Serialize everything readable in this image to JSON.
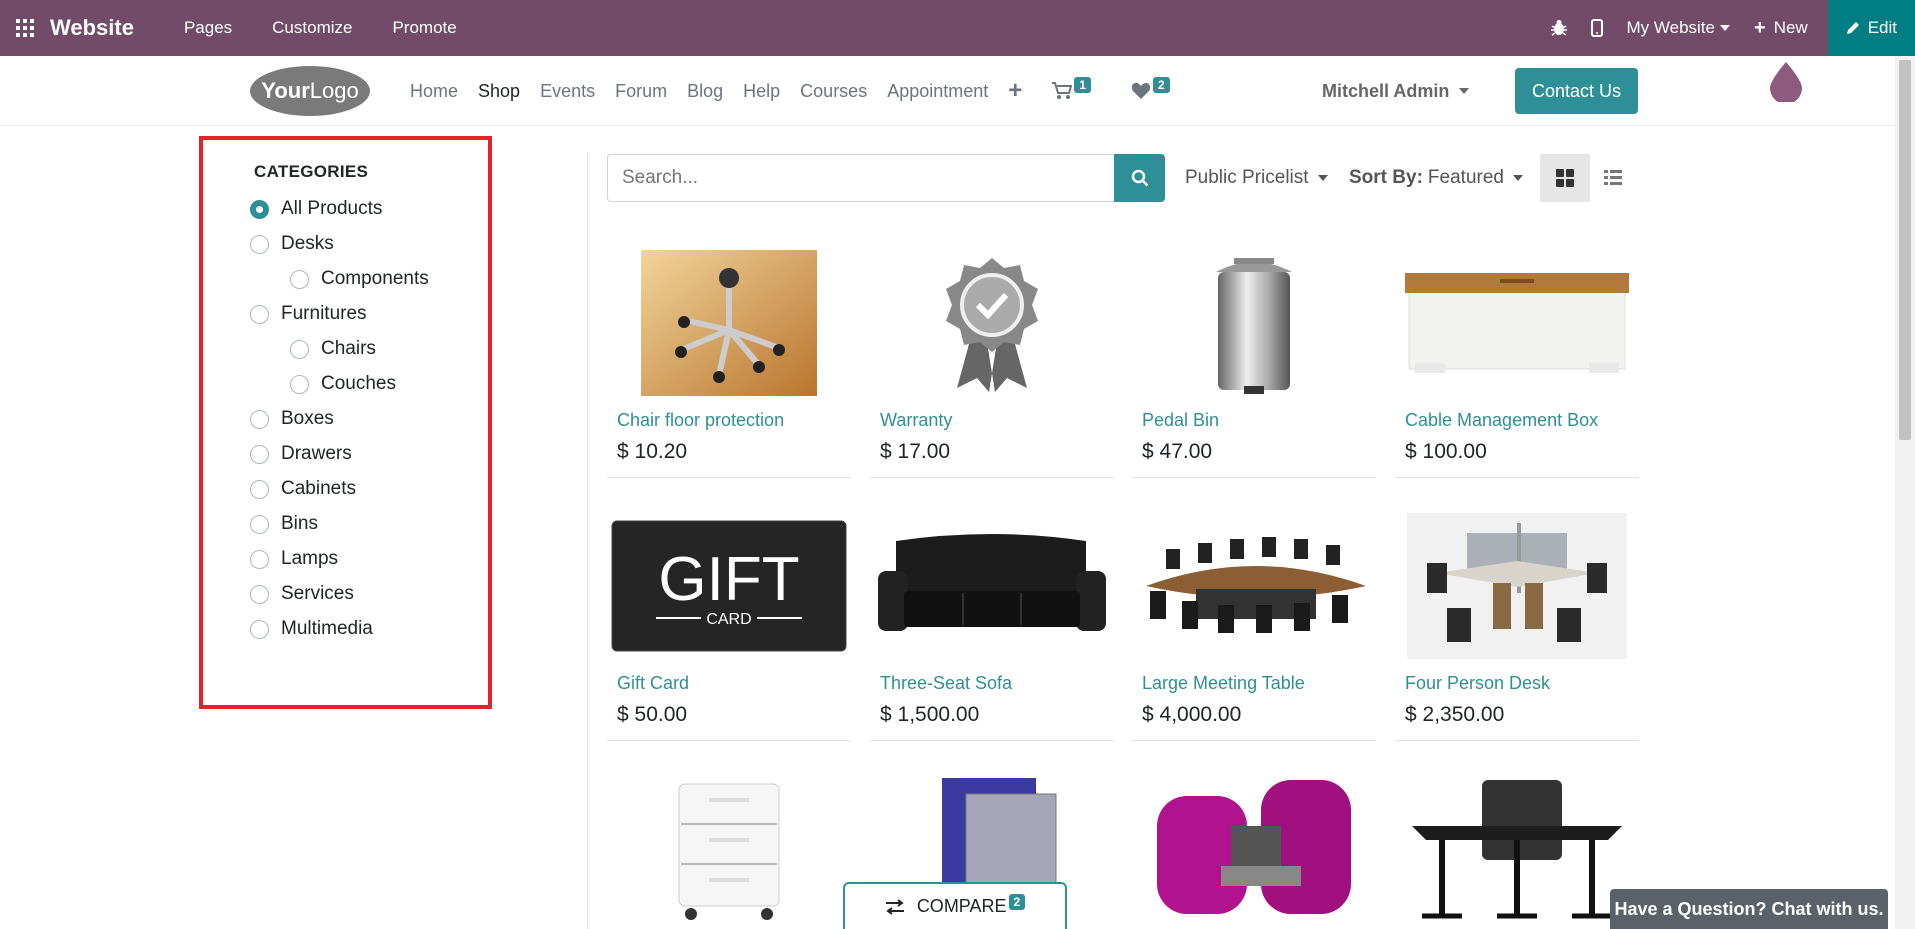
{
  "admin_bar": {
    "brand": "Website",
    "menu": [
      "Pages",
      "Customize",
      "Promote"
    ],
    "site_selector": "My Website",
    "new_label": "New",
    "edit_label": "Edit"
  },
  "navbar": {
    "logo_part1": "Your",
    "logo_part2": "Logo",
    "links": [
      "Home",
      "Shop",
      "Events",
      "Forum",
      "Blog",
      "Help",
      "Courses",
      "Appointment"
    ],
    "active_link": "Shop",
    "cart_count": "1",
    "wishlist_count": "2",
    "user_name": "Mitchell Admin",
    "contact_label": "Contact Us"
  },
  "sidebar": {
    "heading": "CATEGORIES",
    "categories": [
      {
        "label": "All Products",
        "checked": true
      },
      {
        "label": "Desks"
      },
      {
        "label": "Components"
      },
      {
        "label": "Furnitures"
      },
      {
        "label": "Chairs"
      },
      {
        "label": "Couches"
      },
      {
        "label": "Boxes"
      },
      {
        "label": "Drawers"
      },
      {
        "label": "Cabinets"
      },
      {
        "label": "Bins"
      },
      {
        "label": "Lamps"
      },
      {
        "label": "Services"
      },
      {
        "label": "Multimedia"
      }
    ]
  },
  "toolbar": {
    "search_placeholder": "Search...",
    "pricelist": "Public Pricelist",
    "sort_label": "Sort By:",
    "sort_value": "Featured"
  },
  "products": [
    {
      "name": "Chair floor protection",
      "price": "$ 10.20"
    },
    {
      "name": "Warranty",
      "price": "$ 17.00"
    },
    {
      "name": "Pedal Bin",
      "price": "$ 47.00"
    },
    {
      "name": "Cable Management Box",
      "price": "$ 100.00"
    },
    {
      "name": "Gift Card",
      "price": "$ 50.00"
    },
    {
      "name": "Three-Seat Sofa",
      "price": "$ 1,500.00"
    },
    {
      "name": "Large Meeting Table",
      "price": "$ 4,000.00"
    },
    {
      "name": "Four Person Desk",
      "price": "$ 2,350.00"
    }
  ],
  "gift_card_text": {
    "big": "GIFT",
    "small": "CARD"
  },
  "compare": {
    "label": "COMPARE",
    "count": "2"
  },
  "chat_label": "Have a Question? Chat with us.",
  "colors": {
    "admin_bar": "#714b67",
    "accent": "#2f8f96",
    "highlight_box": "#e8222a"
  }
}
